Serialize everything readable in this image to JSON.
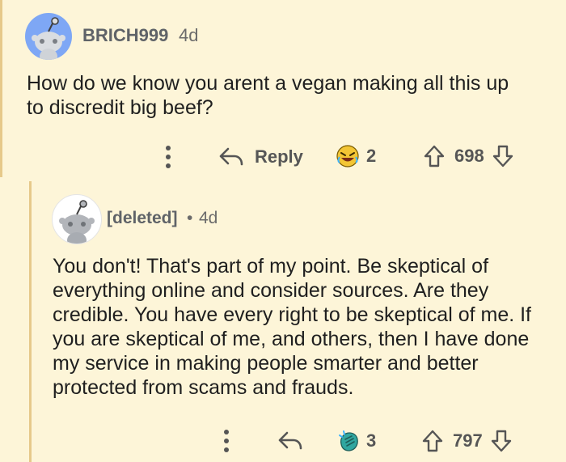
{
  "colors": {
    "background": "#fdf5d8",
    "thread_line": "#e6c98a",
    "username": "#5f6368",
    "action": "#565656",
    "avatar_blue": "#7ea7f5",
    "award_gold": "#f3c534",
    "award_teal": "#30a7a0"
  },
  "comments": [
    {
      "username": "BRICH999",
      "age": "4d",
      "avatar_icon": "snoo-avatar-icon",
      "body": "How do we know you arent a vegan making all this up to discredit big beef?",
      "actions": {
        "more_icon": "more-vertical-icon",
        "reply_icon": "reply-arrow-icon",
        "reply_label": "Reply",
        "award_icon": "laughing-award-icon",
        "award_count": "2",
        "upvote_icon": "upvote-arrow-icon",
        "score": "698",
        "downvote_icon": "downvote-arrow-icon"
      }
    },
    {
      "username": "[deleted]",
      "separator": "•",
      "age": "4d",
      "avatar_icon": "deleted-snoo-avatar-icon",
      "body": "You don't! That's part of my point. Be skeptical of everything online and consider sources. Are they credible. You have every right to be skeptical of me. If you are skeptical of me, and others, then I have done my service in making people smarter and better protected from scams and frauds.",
      "actions": {
        "more_icon": "more-vertical-icon",
        "reply_icon": "reply-arrow-icon",
        "award_icon": "clapping-award-icon",
        "award_count": "3",
        "upvote_icon": "upvote-arrow-icon",
        "score": "797",
        "downvote_icon": "downvote-arrow-icon"
      }
    }
  ]
}
